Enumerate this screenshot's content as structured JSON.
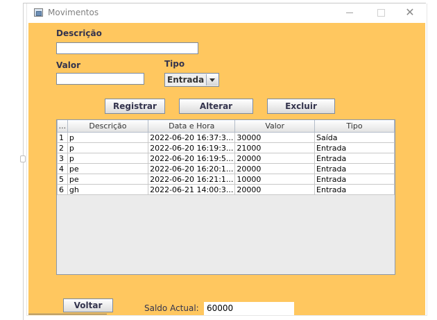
{
  "window": {
    "title": "Movimentos",
    "icon": "java-app-icon"
  },
  "form": {
    "descricao_label": "Descrição",
    "descricao_value": "",
    "valor_label": "Valor",
    "valor_value": "",
    "tipo_label": "Tipo",
    "tipo_selected": "Entrada"
  },
  "buttons": {
    "registrar": "Registrar",
    "alterar": "Alterar",
    "excluir": "Excluir",
    "voltar": "Voltar"
  },
  "table": {
    "headers": [
      "...",
      "Descrição",
      "Data e Hora",
      "Valor",
      "Tipo"
    ],
    "rows": [
      [
        "1",
        "p",
        "2022-06-20 16:37:3...",
        "30000",
        "Saída"
      ],
      [
        "2",
        "p",
        "2022-06-20 16:19:3...",
        "21000",
        "Entrada"
      ],
      [
        "3",
        "p",
        "2022-06-20 16:19:5...",
        "20000",
        "Entrada"
      ],
      [
        "4",
        "pe",
        "2022-06-20 16:20:1...",
        "20000",
        "Entrada"
      ],
      [
        "5",
        "pe",
        "2022-06-20 16:21:1...",
        "10000",
        "Entrada"
      ],
      [
        "6",
        "gh",
        "2022-06-21 14:00:3...",
        "20000",
        "Entrada"
      ]
    ]
  },
  "saldo": {
    "label": "Saldo Actual:",
    "value": "60000"
  },
  "colors": {
    "panel": "#ffc75f",
    "label_text": "#33334d"
  }
}
